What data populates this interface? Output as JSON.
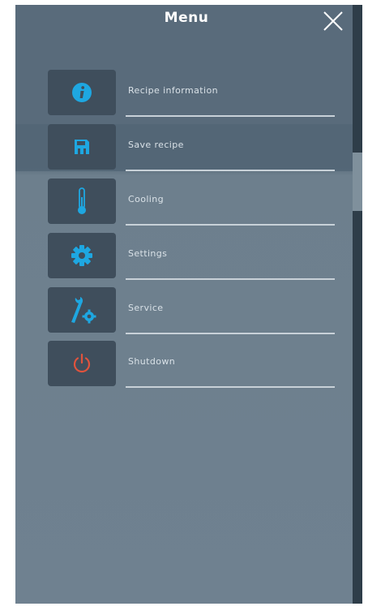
{
  "header": {
    "title": "Menu",
    "close_icon": "close-icon"
  },
  "menu": {
    "items": [
      {
        "label": "Recipe information",
        "icon": "info-icon",
        "icon_color": "#1ea7e1"
      },
      {
        "label": "Save recipe",
        "icon": "save-icon",
        "icon_color": "#1ea7e1"
      },
      {
        "label": "Cooling",
        "icon": "thermometer-icon",
        "icon_color": "#1ea7e1"
      },
      {
        "label": "Settings",
        "icon": "gear-icon",
        "icon_color": "#1ea7e1"
      },
      {
        "label": "Service",
        "icon": "wrench-gear-icon",
        "icon_color": "#1ea7e1"
      },
      {
        "label": "Shutdown",
        "icon": "power-icon",
        "icon_color": "#e0533d"
      }
    ]
  },
  "colors": {
    "panel": "#6f8190",
    "tile": "#3f4e5c",
    "accent": "#1ea7e1",
    "danger": "#e0533d"
  }
}
